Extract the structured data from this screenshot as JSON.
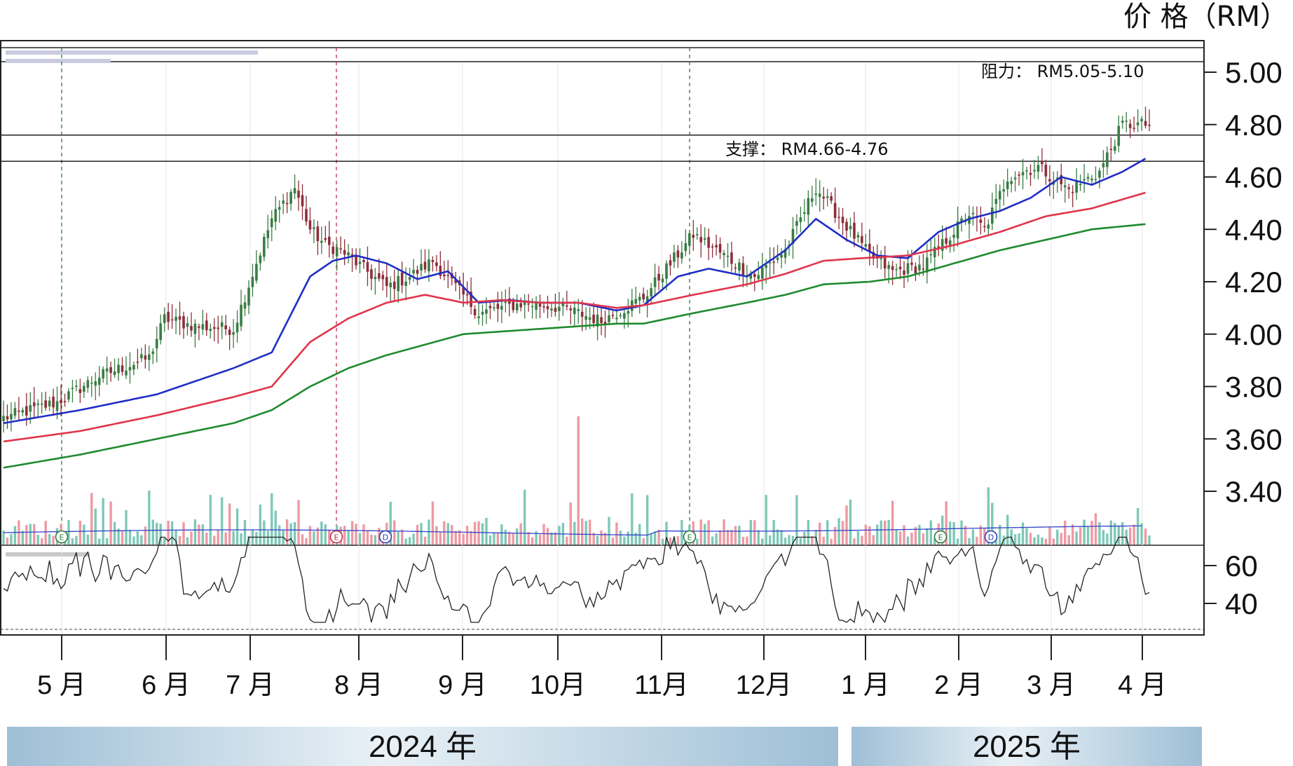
{
  "chart_data": {
    "type": "candlestick",
    "price_axis_title": "价 格（RM）",
    "resistance_label": "阻力：  RM5.05-5.10",
    "support_label": "支撑：  RM4.66-4.76",
    "resistance_band": [
      5.05,
      5.1
    ],
    "support_band": [
      4.66,
      4.76
    ],
    "ylim": [
      3.27,
      5.22
    ],
    "y_ticks": [
      "5.00",
      "4.80",
      "4.60",
      "4.40",
      "4.20",
      "4.00",
      "3.80",
      "3.60",
      "3.40"
    ],
    "rsi_ticks": [
      "60",
      "40"
    ],
    "months": [
      "5 月",
      "6 月",
      "7 月",
      "8 月",
      "9 月",
      "10月",
      "11月",
      "12月",
      "1 月",
      "2 月",
      "3 月",
      "4 月"
    ],
    "years": [
      "2024 年",
      "2025 年"
    ],
    "event_markers": [
      "E",
      "E",
      "D",
      "E",
      "E",
      "D"
    ],
    "close_anchors": {
      "t": [
        0,
        14,
        25,
        38,
        42,
        50,
        60,
        70,
        76,
        80,
        84,
        88,
        100,
        106,
        112,
        124,
        136,
        146,
        156,
        167,
        180,
        196,
        204,
        212,
        226,
        232,
        240,
        252,
        256,
        262,
        270,
        278,
        286,
        292,
        298
      ],
      "v": [
        3.68,
        3.74,
        3.84,
        3.91,
        4.06,
        4.03,
        4.02,
        4.44,
        4.56,
        4.4,
        4.34,
        4.32,
        4.18,
        4.22,
        4.28,
        4.08,
        4.12,
        4.1,
        4.05,
        4.14,
        4.38,
        4.22,
        4.32,
        4.56,
        4.3,
        4.24,
        4.26,
        4.46,
        4.4,
        4.6,
        4.64,
        4.55,
        4.62,
        4.8,
        4.8
      ]
    },
    "moving_averages": [
      {
        "color": "#1f2ec4",
        "t": [
          0,
          20,
          40,
          60,
          70,
          80,
          86,
          92,
          100,
          108,
          116,
          124,
          132,
          140,
          150,
          160,
          167,
          176,
          184,
          194,
          204,
          212,
          220,
          228,
          236,
          244,
          252,
          260,
          268,
          276,
          284,
          292,
          298
        ],
        "v": [
          3.66,
          3.71,
          3.77,
          3.87,
          3.93,
          4.22,
          4.28,
          4.3,
          4.27,
          4.21,
          4.24,
          4.12,
          4.13,
          4.12,
          4.12,
          4.09,
          4.11,
          4.22,
          4.25,
          4.22,
          4.32,
          4.44,
          4.36,
          4.3,
          4.29,
          4.39,
          4.44,
          4.47,
          4.52,
          4.6,
          4.57,
          4.62,
          4.67
        ]
      },
      {
        "color": "#e0344a",
        "t": [
          0,
          20,
          40,
          60,
          70,
          80,
          90,
          100,
          110,
          120,
          130,
          140,
          150,
          160,
          167,
          180,
          194,
          204,
          214,
          224,
          236,
          248,
          260,
          272,
          284,
          298
        ],
        "v": [
          3.59,
          3.63,
          3.69,
          3.76,
          3.8,
          3.97,
          4.06,
          4.12,
          4.15,
          4.12,
          4.13,
          4.12,
          4.12,
          4.1,
          4.11,
          4.15,
          4.19,
          4.23,
          4.28,
          4.29,
          4.3,
          4.34,
          4.39,
          4.45,
          4.48,
          4.54
        ]
      },
      {
        "color": "#1f8a2e",
        "t": [
          0,
          20,
          40,
          60,
          70,
          80,
          90,
          100,
          110,
          120,
          130,
          140,
          150,
          160,
          167,
          180,
          194,
          204,
          214,
          226,
          236,
          248,
          260,
          272,
          284,
          298
        ],
        "v": [
          3.49,
          3.54,
          3.6,
          3.66,
          3.71,
          3.8,
          3.87,
          3.92,
          3.96,
          4.0,
          4.01,
          4.02,
          4.03,
          4.04,
          4.04,
          4.08,
          4.12,
          4.15,
          4.19,
          4.2,
          4.22,
          4.27,
          4.32,
          4.36,
          4.4,
          4.42
        ]
      }
    ]
  }
}
